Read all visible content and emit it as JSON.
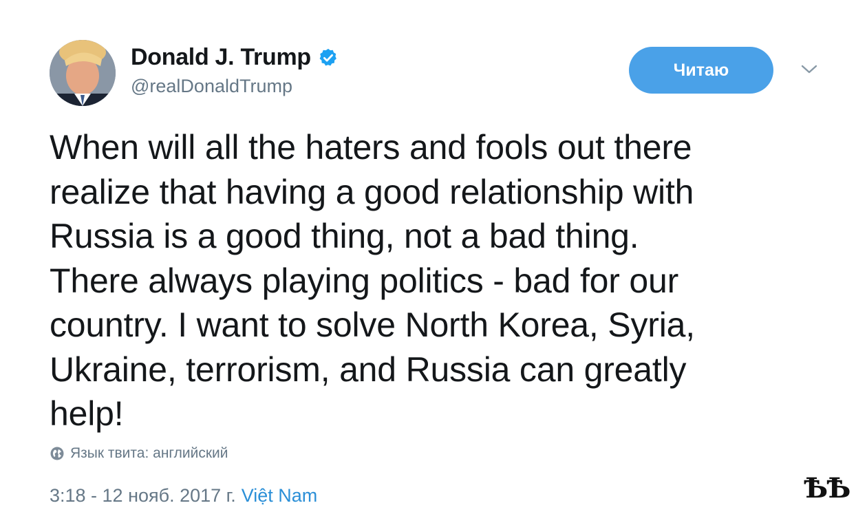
{
  "author": {
    "display_name": "Donald J. Trump",
    "handle": "@realDonaldTrump",
    "verified": true,
    "avatar_icon": "profile-photo",
    "verified_icon": "verified-badge-icon"
  },
  "actions": {
    "follow_label": "Читаю",
    "menu_icon": "chevron-down-icon"
  },
  "tweet": {
    "text": "When will all the haters and fools out there\nrealize that having a good relationship with\nRussia is a good thing, not a bad thing.\nThere always playing politics - bad for our\ncountry. I want to solve North Korea, Syria,\nUkraine, terrorism, and Russia can greatly\nhelp!",
    "language_label": "Язык твита: английский",
    "language_icon": "globe-icon"
  },
  "meta": {
    "timestamp": "3:18 - 12 нояб. 2017 г.",
    "location": "Việt Nam"
  },
  "watermark": {
    "text": "ѢѢ"
  },
  "colors": {
    "follow_button_bg": "#4aa1e8",
    "link": "#2b8fd7",
    "secondary_text": "#657786",
    "primary_text": "#14171a",
    "verified_badge": "#1da1f2"
  }
}
